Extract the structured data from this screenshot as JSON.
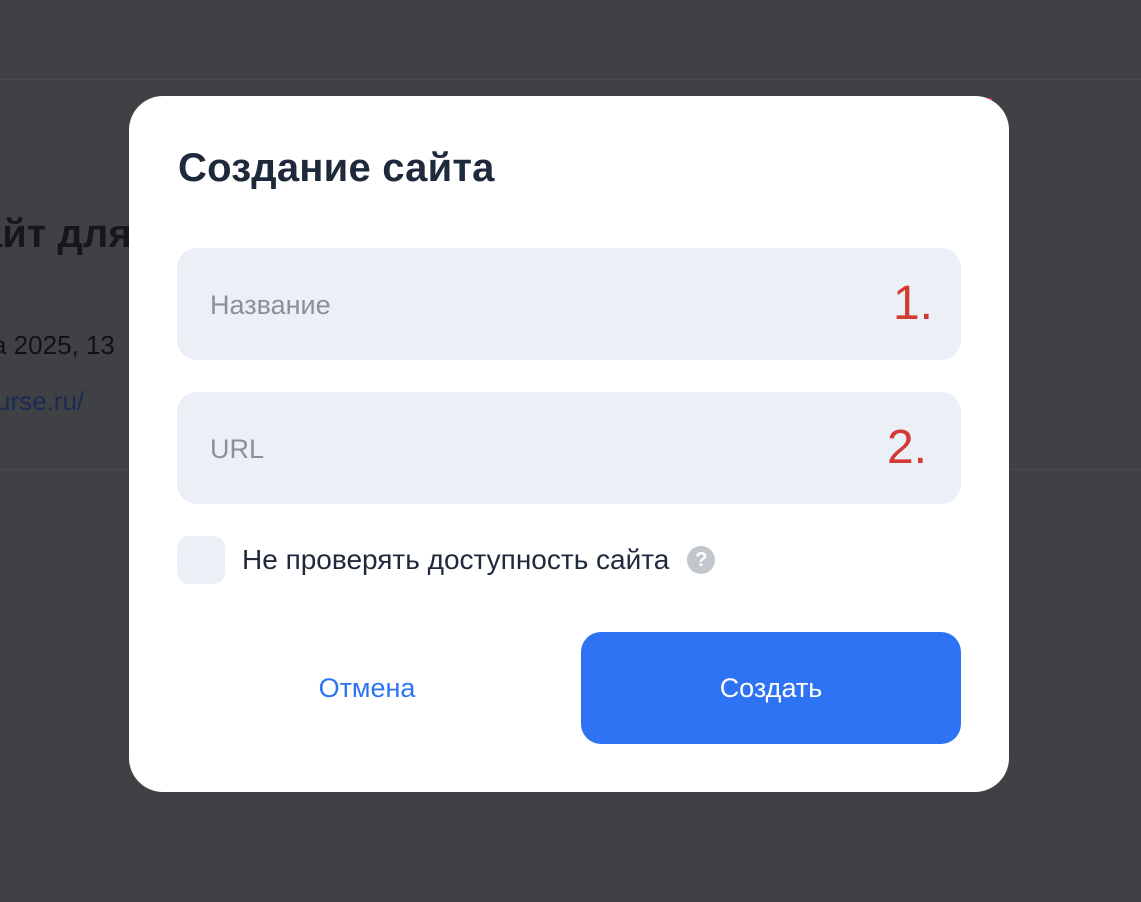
{
  "background": {
    "title_fragment": "айт для",
    "date_fragment": "а 2025, 13",
    "link_fragment": "urse.ru/"
  },
  "modal": {
    "title": "Создание сайта",
    "name_field": {
      "placeholder": "Название",
      "annotation": "1."
    },
    "url_field": {
      "placeholder": "URL",
      "annotation": "2."
    },
    "checkbox": {
      "label": "Не проверять доступность сайта",
      "checked": false,
      "help_icon": "question-circle-icon"
    },
    "cancel_label": "Отмена",
    "create_label": "Создать"
  },
  "colors": {
    "overlay": "#404144",
    "primary": "#2f73f5",
    "field_bg": "#ebeff6",
    "title_text": "#1e2a3c",
    "annotation": "#d33a33"
  }
}
